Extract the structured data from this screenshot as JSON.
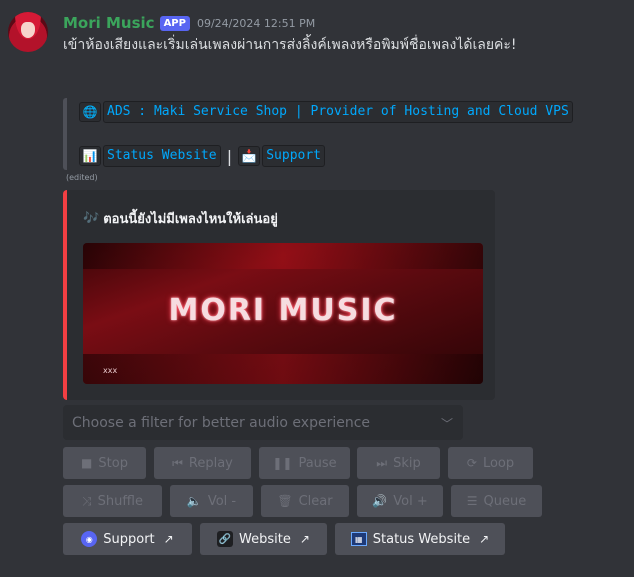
{
  "message": {
    "username": "Mori Music",
    "badge": "APP",
    "timestamp": "09/24/2024 12:51 PM",
    "text": "เข้าห้องเสียงและเริ่มเล่นเพลงผ่านการส่งลิ้งค์เพลงหรือพิมพ์ชื่อเพลงได้เลยค่ะ!",
    "edited_label": "(edited)"
  },
  "links": {
    "ads_emoji": "🌐",
    "ads_text": "ADS : Maki Service Shop | Provider of Hosting and Cloud VPS",
    "status_emoji": "📊",
    "status_text": "Status Website",
    "separator": "|",
    "support_emoji": "📩",
    "support_text": "Support"
  },
  "embed": {
    "title_emoji": "🎶",
    "title": "ตอนนี้ยังไม่มีเพลงไหนให้เล่นอยู่",
    "banner_title": "MORI MUSIC",
    "banner_small": "xxx",
    "accent_color": "#f23f43"
  },
  "select": {
    "placeholder": "Choose a filter for better audio experience"
  },
  "controls": {
    "stop": "Stop",
    "replay": "Replay",
    "pause": "Pause",
    "skip": "Skip",
    "loop": "Loop",
    "shuffle": "Shuffle",
    "vol_down": "Vol -",
    "clear": "Clear",
    "vol_up": "Vol +",
    "queue": "Queue"
  },
  "link_buttons": {
    "support": "Support",
    "website": "Website",
    "status_website": "Status Website"
  },
  "icons": {
    "stop": "stop-icon",
    "replay": "previous-icon",
    "pause": "pause-icon",
    "skip": "next-icon",
    "loop": "loop-icon",
    "shuffle": "shuffle-icon",
    "vol_down": "volume-down-icon",
    "clear": "trash-icon",
    "vol_up": "volume-up-icon",
    "queue": "queue-icon",
    "external": "external-link-icon"
  }
}
